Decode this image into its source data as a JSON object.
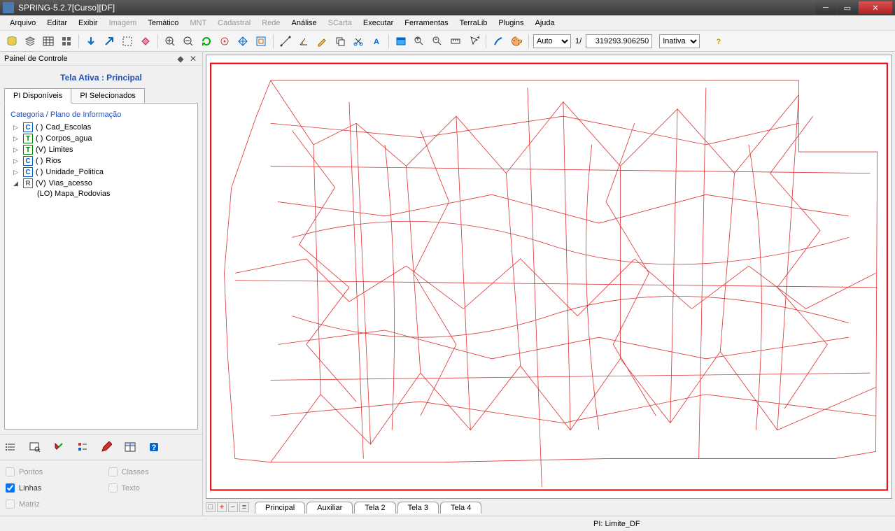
{
  "window": {
    "title": "SPRING-5.2.7[Curso][DF]"
  },
  "menu": {
    "arquivo": "Arquivo",
    "editar": "Editar",
    "exibir": "Exibir",
    "imagem": "Imagem",
    "tematico": "Temático",
    "mnt": "MNT",
    "cadastral": "Cadastral",
    "rede": "Rede",
    "analise": "Análise",
    "scarta": "SCarta",
    "executar": "Executar",
    "ferramentas": "Ferramentas",
    "terralib": "TerraLib",
    "plugins": "Plugins",
    "ajuda": "Ajuda"
  },
  "toolbar": {
    "scale_mode": "Auto",
    "ratio_label": "1/",
    "scale_value": "319293.906250",
    "state": "Inativa"
  },
  "panel": {
    "title": "Painel de Controle",
    "tela_ativa": "Tela Ativa : Principal",
    "tabs": {
      "disponiveis": "PI Disponíveis",
      "selecionados": "PI Selecionados"
    },
    "cat_header": "Categoria / Plano de Informação",
    "tree": [
      {
        "type": "C",
        "status": "( )",
        "label": "Cad_Escolas",
        "expanded": false
      },
      {
        "type": "T",
        "status": "( )",
        "label": "Corpos_agua",
        "expanded": false
      },
      {
        "type": "T",
        "status": "(V)",
        "label": "Limites",
        "expanded": false
      },
      {
        "type": "C",
        "status": "( )",
        "label": "Rios",
        "expanded": false
      },
      {
        "type": "C",
        "status": "( )",
        "label": "Unidade_Politica",
        "expanded": false
      },
      {
        "type": "R",
        "status": "(V)",
        "label": "Vias_acesso",
        "expanded": true,
        "children": [
          {
            "label": "(LO) Mapa_Rodovias"
          }
        ]
      }
    ],
    "checks": {
      "pontos": "Pontos",
      "linhas": "Linhas",
      "matriz": "Matriz",
      "classes": "Classes",
      "texto": "Texto"
    }
  },
  "view_tabs": [
    "Principal",
    "Auxiliar",
    "Tela 2",
    "Tela 3",
    "Tela 4"
  ],
  "statusbar": {
    "pi": "PI: Limite_DF"
  }
}
